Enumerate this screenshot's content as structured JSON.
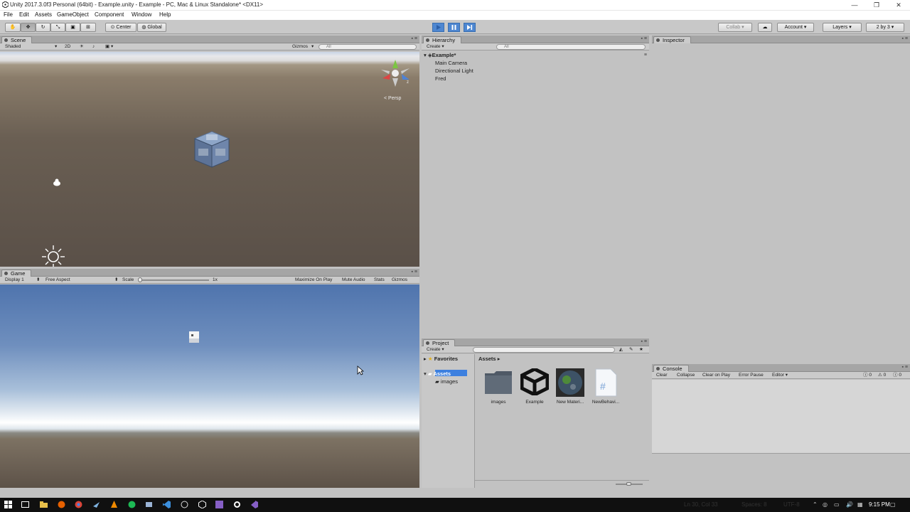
{
  "window": {
    "title": "Unity 2017.3.0f3 Personal (64bit) - Example.unity - Example - PC, Mac & Linux Standalone* <DX11>"
  },
  "menu": [
    "File",
    "Edit",
    "Assets",
    "GameObject",
    "Component",
    "Window",
    "Help"
  ],
  "toolbar": {
    "pivot": "Center",
    "space": "Global",
    "collab": "Collab",
    "account": "Account",
    "layers": "Layers",
    "layout": "2 by 3"
  },
  "scene": {
    "tab": "Scene",
    "shading": "Shaded",
    "mode_2d": "2D",
    "gizmos": "Gizmos",
    "search_placeholder": "All",
    "persp_label": "Persp"
  },
  "game": {
    "tab": "Game",
    "display": "Display 1",
    "aspect": "Free Aspect",
    "scale_label": "Scale",
    "scale_value": "1x",
    "maximize": "Maximize On Play",
    "mute": "Mute Audio",
    "stats": "Stats",
    "gizmos": "Gizmos"
  },
  "hierarchy": {
    "tab": "Hierarchy",
    "create": "Create",
    "search_placeholder": "All",
    "scene_name": "Example*",
    "items": [
      "Main Camera",
      "Directional Light",
      "Fred"
    ]
  },
  "inspector": {
    "tab": "Inspector"
  },
  "project": {
    "tab": "Project",
    "create": "Create",
    "favorites": "Favorites",
    "assets_root": "Assets",
    "assets_folder": "images",
    "breadcrumb": "Assets",
    "assets": [
      "images",
      "Example",
      "New Materi...",
      "NewBehavi..."
    ]
  },
  "console": {
    "tab": "Console",
    "buttons": [
      "Clear",
      "Collapse",
      "Clear on Play",
      "Error Pause",
      "Editor"
    ],
    "counts": [
      "0",
      "0",
      "0"
    ]
  },
  "taskbar": {
    "status": "Ln 30, Col 33",
    "spaces": "Spaces: 8",
    "encoding": "UTF-8",
    "time": "9:15 PM"
  }
}
